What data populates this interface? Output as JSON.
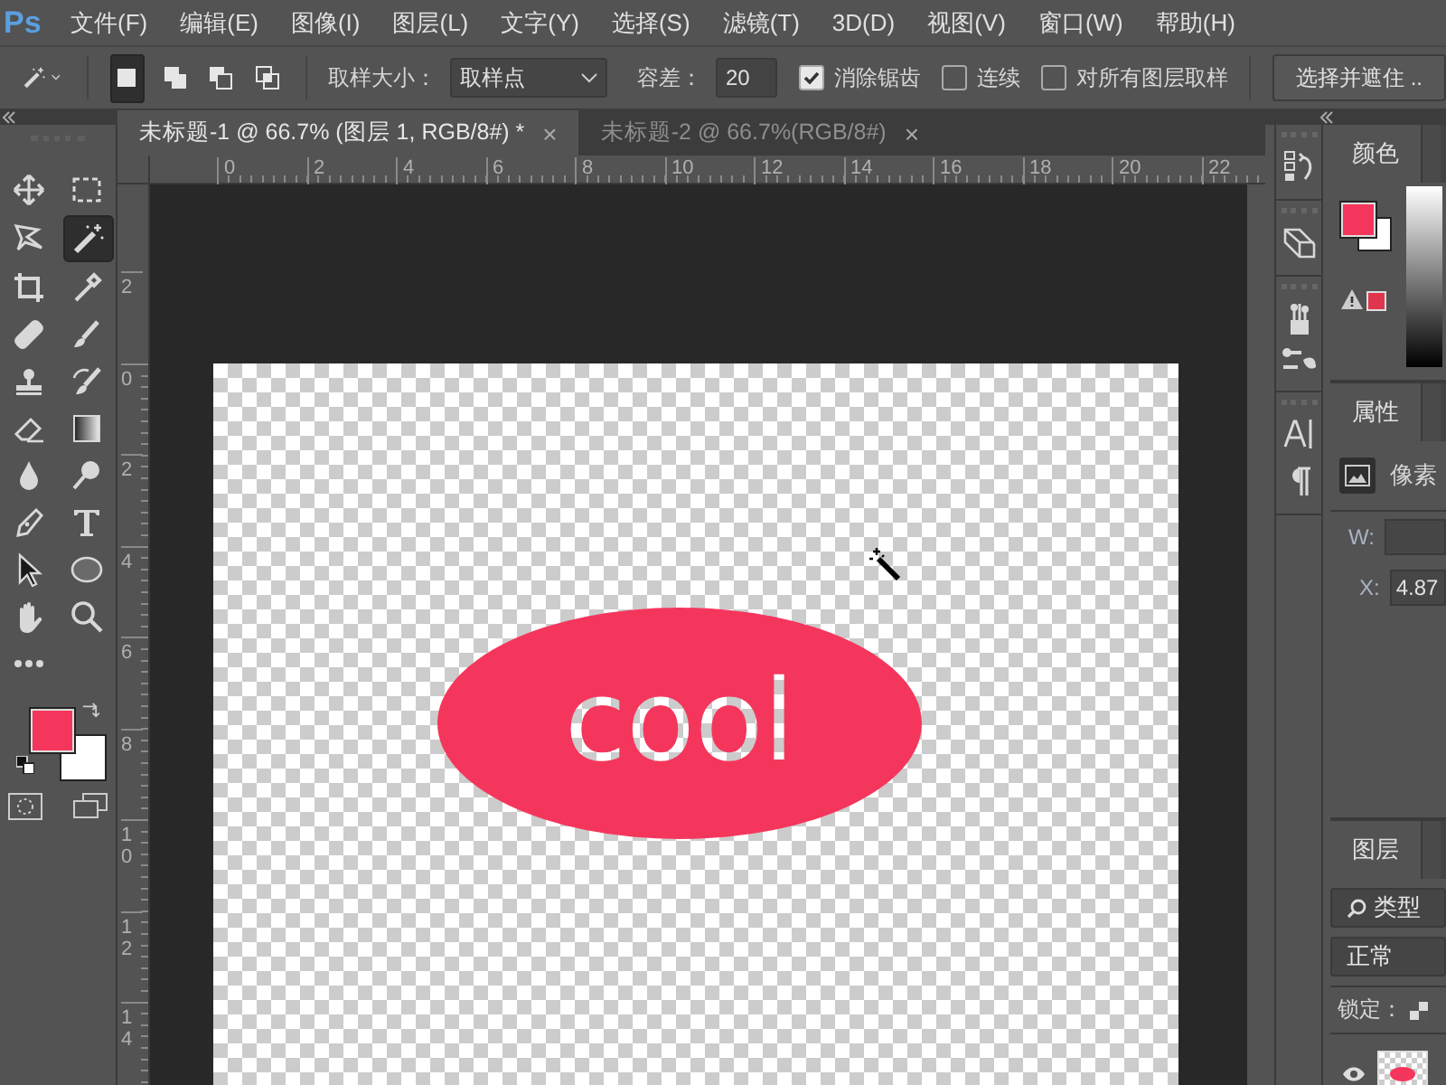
{
  "app_logo": "Ps",
  "menu": [
    "文件(F)",
    "编辑(E)",
    "图像(I)",
    "图层(L)",
    "文字(Y)",
    "选择(S)",
    "滤镜(T)",
    "3D(D)",
    "视图(V)",
    "窗口(W)",
    "帮助(H)"
  ],
  "options_bar": {
    "mode_buttons": [
      {
        "selected": true
      },
      {
        "selected": false
      },
      {
        "selected": false
      },
      {
        "selected": false
      }
    ],
    "sample_size_label": "取样大小：",
    "sample_size": "取样点",
    "tolerance_label": "容差：",
    "tolerance": "20",
    "checkboxes": [
      {
        "label": "消除锯齿",
        "checked": true
      },
      {
        "label": "连续",
        "checked": false
      },
      {
        "label": "对所有图层取样",
        "checked": false
      }
    ],
    "select_mask_button": "选择并遮住 .."
  },
  "document_tabs": [
    {
      "title": "未标题-1 @ 66.7% (图层 1, RGB/8#) *",
      "close": "×",
      "selected": true
    },
    {
      "title": "未标题-2 @ 66.7%(RGB/8#)",
      "close": "×",
      "selected": false
    }
  ],
  "rulers": {
    "horizontal": [
      "0",
      "2",
      "4",
      "6",
      "8",
      "10",
      "12",
      "14",
      "16",
      "18",
      "20",
      "22"
    ],
    "vertical": [
      "2",
      "0",
      "2",
      "4",
      "6",
      "8",
      "10",
      "12",
      "14"
    ]
  },
  "canvas": {
    "text": "cool"
  },
  "tools": [
    {
      "selected": false
    },
    {
      "selected": false
    },
    {
      "selected": false
    },
    {
      "selected": true
    },
    {
      "selected": false
    },
    {
      "selected": false
    },
    {
      "selected": false
    },
    {
      "selected": false
    },
    {
      "selected": false
    },
    {
      "selected": false
    },
    {
      "selected": false
    },
    {
      "selected": false
    },
    {
      "selected": false
    },
    {
      "selected": false
    },
    {
      "selected": false
    },
    {
      "selected": false
    },
    {
      "selected": false
    },
    {
      "selected": false
    },
    {
      "selected": false
    },
    {
      "selected": false
    },
    {
      "selected": false
    }
  ],
  "color_panel": {
    "tab": "颜色"
  },
  "properties_panel": {
    "tab": "属性",
    "kind_label": "像素",
    "fields": [
      {
        "label": "W:"
      },
      {
        "label": "X:",
        "value": "4.87"
      }
    ]
  },
  "layers_panel": {
    "tab": "图层",
    "filter": "类型",
    "blend_mode": "正常",
    "lock_label": "锁定：",
    "layers": [
      {
        "visible": true
      }
    ]
  }
}
